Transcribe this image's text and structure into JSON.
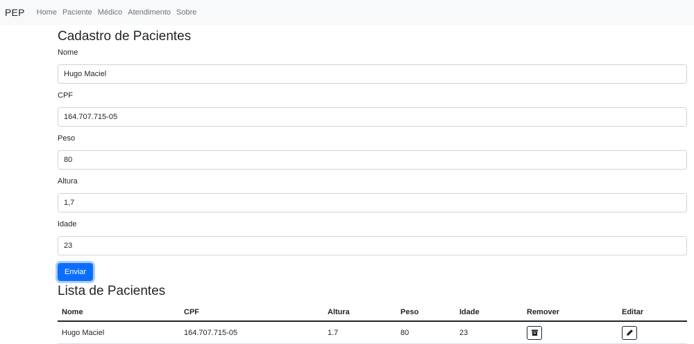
{
  "navbar": {
    "brand": "PEP",
    "links": [
      "Home",
      "Paciente",
      "Médico",
      "Atendimento",
      "Sobre"
    ]
  },
  "form": {
    "title": "Cadastro de Pacientes",
    "fields": [
      {
        "label": "Nome",
        "value": "Hugo Maciel"
      },
      {
        "label": "CPF",
        "value": "164.707.715-05"
      },
      {
        "label": "Peso",
        "value": "80"
      },
      {
        "label": "Altura",
        "value": "1,7"
      },
      {
        "label": "Idade",
        "value": "23"
      }
    ],
    "submit_label": "Enviar"
  },
  "list": {
    "title": "Lista de Pacientes",
    "headers": [
      "Nome",
      "CPF",
      "Altura",
      "Peso",
      "Idade",
      "Remover",
      "Editar"
    ],
    "rows": [
      {
        "nome": "Hugo Maciel",
        "cpf": "164.707.715-05",
        "altura": "1.7",
        "peso": "80",
        "idade": "23",
        "remove_icon": "trash-icon",
        "edit_icon": "pencil-icon"
      }
    ]
  },
  "colors": {
    "primary": "#0d6efd",
    "navbar_bg": "#f8f9fa"
  }
}
